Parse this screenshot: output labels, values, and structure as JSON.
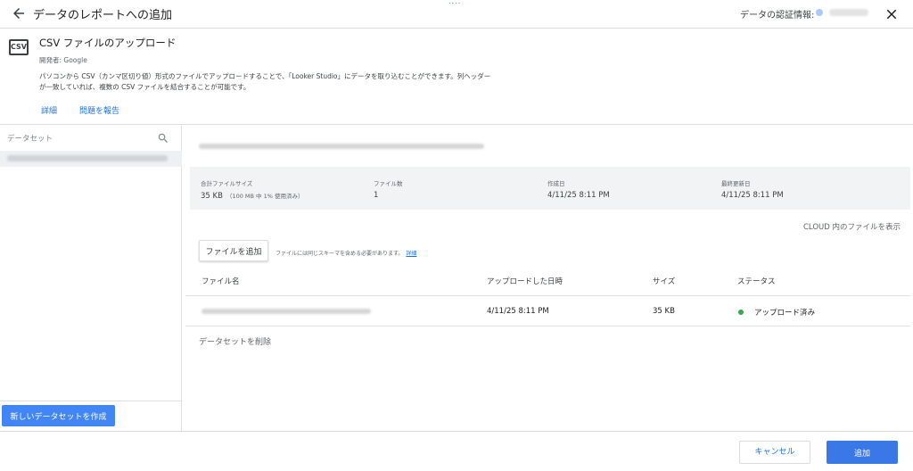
{
  "colors": {
    "accent": "#1a73e8",
    "primary_button": "#3b78e7",
    "new_dataset_button": "#4285f4",
    "status_ok": "#34a853"
  },
  "topbar": {
    "title": "データのレポートへの追加",
    "back_icon": "arrow-left-icon",
    "drag_indicator": "....",
    "auth_label": "データの認証情報:",
    "close_icon": "close-icon"
  },
  "connector": {
    "icon_text": "CSV",
    "name": "CSV ファイルのアップロード",
    "developer": "開発者: Google",
    "description": "パソコンから CSV（カンマ区切り値）形式のファイルでアップロードすることで、「Looker Studio」にデータを取り込むことができます。列ヘッダーが一致していれば、複数の CSV ファイルを結合することが可能です。",
    "link_details": "詳細",
    "link_report": "問題を報告"
  },
  "sidebar": {
    "search_placeholder": "データセット",
    "search_icon": "search-icon",
    "new_dataset_button": "新しいデータセットを作成"
  },
  "main": {
    "stats": {
      "total_size_label": "合計ファイルサイズ",
      "total_size_value": "35 KB",
      "total_size_sub": "（100 MB 中 1% 使用済み）",
      "file_count_label": "ファイル数",
      "file_count_value": "1",
      "created_label": "作成日",
      "created_value": "4/11/25 8:11 PM",
      "updated_label": "最終更新日",
      "updated_value": "4/11/25 8:11 PM"
    },
    "cloud_link": "CLOUD 内のファイルを表示",
    "add_file_button": "ファイルを追加",
    "add_file_note": "ファイルには同じスキーマを含める必要があります。",
    "add_file_note_link": "詳細",
    "table": {
      "headers": [
        "ファイル名",
        "アップロードした日時",
        "サイズ",
        "ステータス"
      ],
      "rows": [
        {
          "uploaded": "4/11/25 8:11 PM",
          "size": "35 KB",
          "status": "アップロード済み"
        }
      ]
    },
    "delete_dataset": "データセットを削除"
  },
  "footer": {
    "cancel": "キャンセル",
    "add": "追加"
  }
}
